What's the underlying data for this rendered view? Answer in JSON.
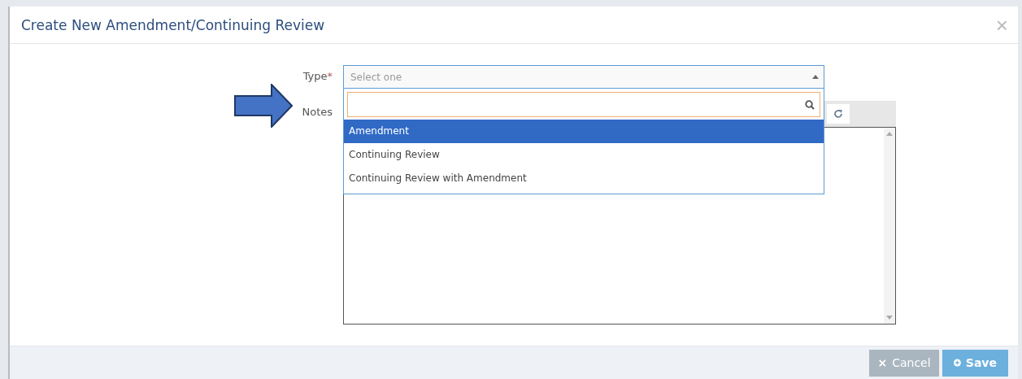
{
  "dialog": {
    "title": "Create New Amendment/Continuing Review",
    "close": "×"
  },
  "type_field": {
    "label": "Type",
    "required_mark": "*",
    "placeholder": "Select one",
    "expanded": true,
    "options": [
      {
        "label": "Amendment",
        "selected": true
      },
      {
        "label": "Continuing Review",
        "selected": false
      },
      {
        "label": "Continuing Review with Amendment",
        "selected": false
      }
    ]
  },
  "notes_field": {
    "label": "Notes"
  },
  "buttons": [
    {
      "kind": "cancel",
      "label": "Cancel",
      "icon": "×"
    },
    {
      "kind": "save",
      "label": "Save"
    }
  ]
}
